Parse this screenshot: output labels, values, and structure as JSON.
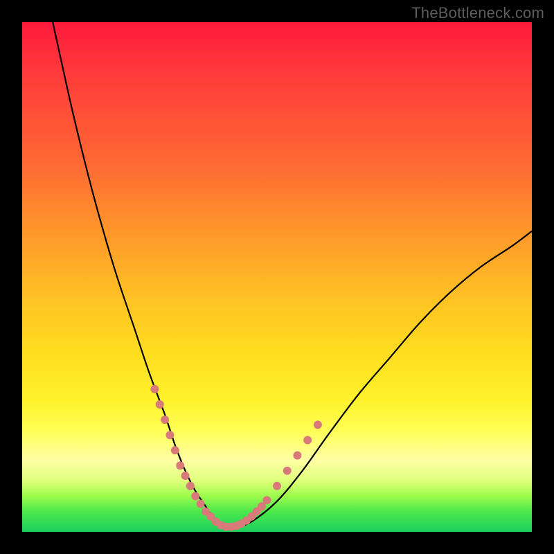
{
  "watermark": "TheBottleneck.com",
  "chart_data": {
    "type": "line",
    "title": "",
    "xlabel": "",
    "ylabel": "",
    "xlim": [
      0,
      100
    ],
    "ylim": [
      0,
      100
    ],
    "series": [
      {
        "name": "bottleneck-curve",
        "x": [
          6,
          10,
          14,
          18,
          22,
          25,
          28,
          30,
          32,
          34,
          36,
          38,
          40,
          42,
          45,
          50,
          55,
          60,
          66,
          72,
          78,
          84,
          90,
          96,
          100
        ],
        "values": [
          100,
          82,
          66,
          52,
          40,
          31,
          23,
          17,
          12,
          8,
          5,
          2,
          1,
          1,
          2,
          6,
          12,
          19,
          27,
          34,
          41,
          47,
          52,
          56,
          59
        ]
      }
    ],
    "markers": {
      "name": "highlight-dots",
      "color": "#d87a7a",
      "x": [
        26,
        27,
        28,
        29,
        30,
        31,
        32,
        33,
        34,
        35,
        36,
        37,
        38,
        39,
        40,
        41,
        42,
        43,
        44,
        45,
        46,
        47,
        48,
        50,
        52,
        54,
        56,
        58
      ],
      "values": [
        28,
        25,
        22,
        19,
        16,
        13,
        11,
        9,
        7,
        5.5,
        4,
        3,
        2,
        1.3,
        1,
        1,
        1.2,
        1.6,
        2.2,
        3,
        4,
        5,
        6.2,
        9,
        12,
        15,
        18,
        21
      ]
    },
    "gradient_stops": [
      {
        "pos": 0,
        "color": "#ff1a3c"
      },
      {
        "pos": 28,
        "color": "#ff6a33"
      },
      {
        "pos": 55,
        "color": "#ffc423"
      },
      {
        "pos": 80,
        "color": "#ffff55"
      },
      {
        "pos": 93,
        "color": "#9cfc4c"
      },
      {
        "pos": 100,
        "color": "#1ccf5e"
      }
    ]
  }
}
